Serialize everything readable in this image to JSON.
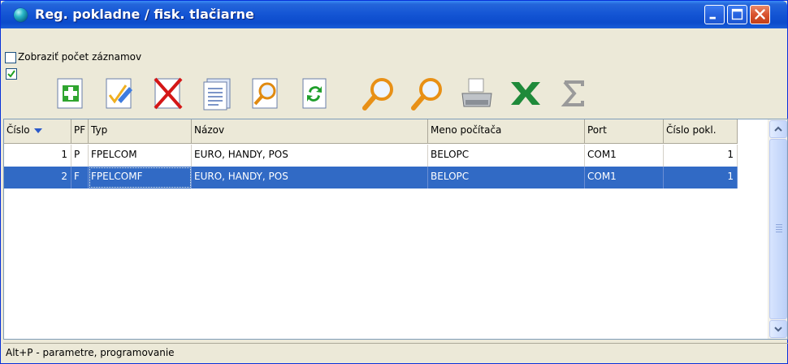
{
  "window": {
    "title": "Reg. pokladne / fisk. tlačiarne"
  },
  "options": {
    "show_count_label": "Zobraziť počet záznamov",
    "show_count_checked": false,
    "second_checkbox_checked": true
  },
  "toolbar": {
    "items": [
      {
        "name": "add-icon"
      },
      {
        "name": "edit-icon"
      },
      {
        "name": "delete-icon"
      },
      {
        "name": "copy-icon"
      },
      {
        "name": "view-icon"
      },
      {
        "name": "refresh-icon"
      },
      {
        "name": "search-icon"
      },
      {
        "name": "search-next-icon"
      },
      {
        "name": "print-icon"
      },
      {
        "name": "excel-export-icon"
      },
      {
        "name": "sum-icon"
      }
    ]
  },
  "table": {
    "columns": [
      "Číslo",
      "PF",
      "Typ",
      "Názov",
      "Meno počítača",
      "Port",
      "Číslo pokl."
    ],
    "rows": [
      {
        "cislo": "1",
        "pf": "P",
        "typ": "FPELCOM",
        "nazov": "EURO, HANDY, POS",
        "meno": "BELOPC",
        "port": "COM1",
        "cislo_pokl": "1",
        "selected": false
      },
      {
        "cislo": "2",
        "pf": "F",
        "typ": "FPELCOMF",
        "nazov": "EURO, HANDY, POS",
        "meno": "BELOPC",
        "port": "COM1",
        "cislo_pokl": "1",
        "selected": true
      }
    ]
  },
  "status": {
    "hint": "Alt+P - parametre, programovanie"
  },
  "colors": {
    "selection": "#316AC5",
    "titlebar": "#0B4BCB",
    "close": "#D9532E"
  }
}
